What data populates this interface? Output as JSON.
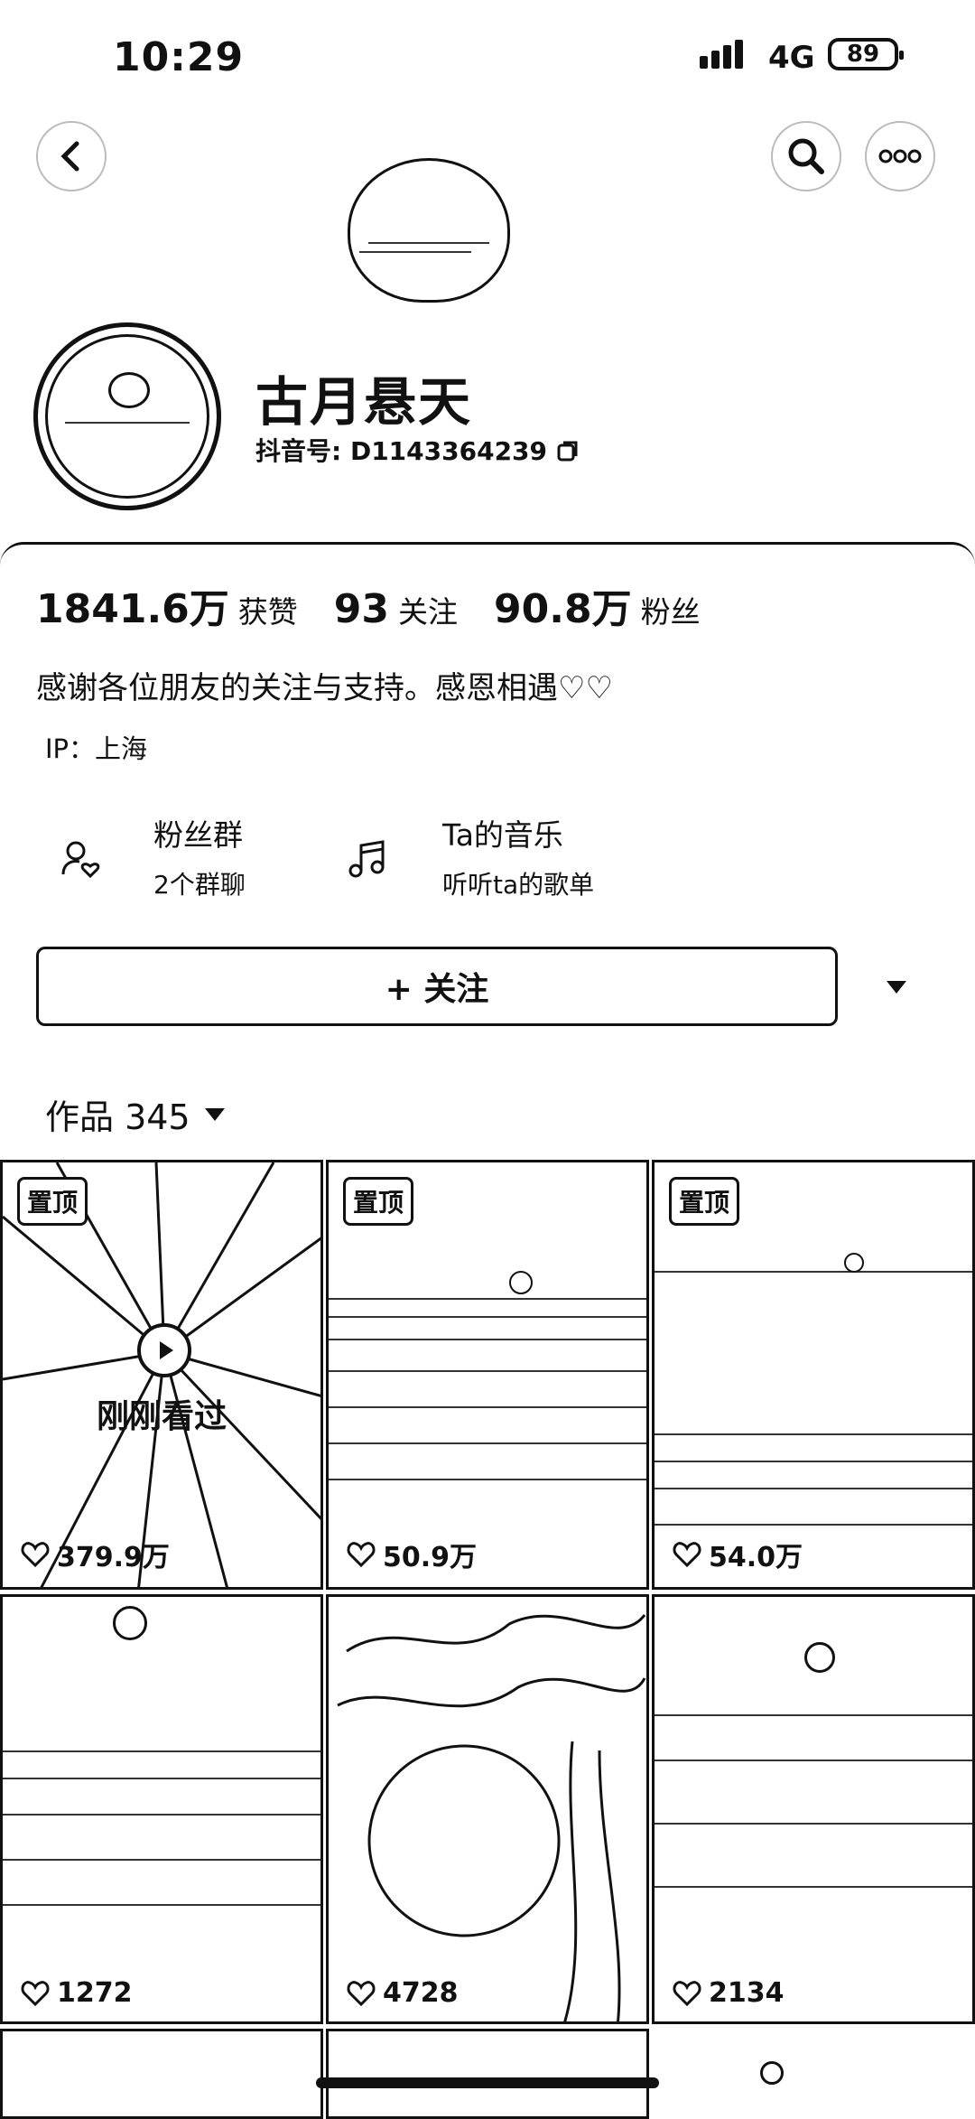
{
  "status_bar": {
    "time": "10:29",
    "network": "4G",
    "battery": "89"
  },
  "profile": {
    "name": "古月悬天",
    "douyin_id": "抖音号: D1143364239",
    "stats": [
      {
        "value": "1841.6万",
        "label": "获赞"
      },
      {
        "value": "93",
        "label": "关注"
      },
      {
        "value": "90.8万",
        "label": "粉丝"
      }
    ],
    "bio": "感谢各位朋友的关注与支持。感恩相遇♡♡",
    "ip": "IP：上海"
  },
  "features": {
    "fans_group": {
      "title": "粉丝群",
      "subtitle": "2个群聊"
    },
    "music": {
      "title": "Ta的音乐",
      "subtitle": "听听ta的歌单"
    }
  },
  "follow_button": "+ 关注",
  "works": {
    "label": "作品 345"
  },
  "videos": [
    {
      "pinned": "置顶",
      "likes": "379.9万",
      "badge": "刚刚看过"
    },
    {
      "pinned": "置顶",
      "likes": "50.9万"
    },
    {
      "pinned": "置顶",
      "likes": "54.0万"
    },
    {
      "likes": "1272"
    },
    {
      "likes": "4728"
    },
    {
      "likes": "2134"
    }
  ]
}
